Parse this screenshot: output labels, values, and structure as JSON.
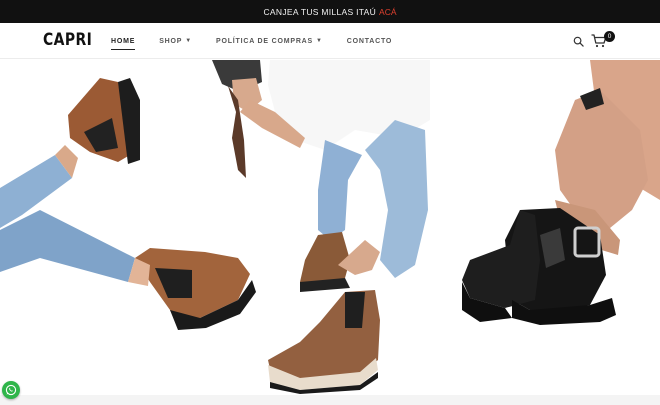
{
  "announcement": {
    "text": "CANJEA TUS MILLAS ITAÚ",
    "link_label": "ACÁ",
    "link_color": "#e0412f"
  },
  "header": {
    "logo": "CAPRI",
    "nav": [
      {
        "label": "HOME",
        "active": true,
        "dropdown": false
      },
      {
        "label": "SHOP",
        "active": false,
        "dropdown": true
      },
      {
        "label": "POLÍTICA DE COMPRAS",
        "active": false,
        "dropdown": true
      },
      {
        "label": "CONTACTO",
        "active": false,
        "dropdown": false
      }
    ],
    "search_icon": "search-icon",
    "cart_icon": "cart-icon",
    "cart_count": "0"
  },
  "hero": {
    "image_subject": "boots campaign photo"
  },
  "whatsapp": {
    "icon": "whatsapp-icon",
    "color": "#2fb54a"
  }
}
